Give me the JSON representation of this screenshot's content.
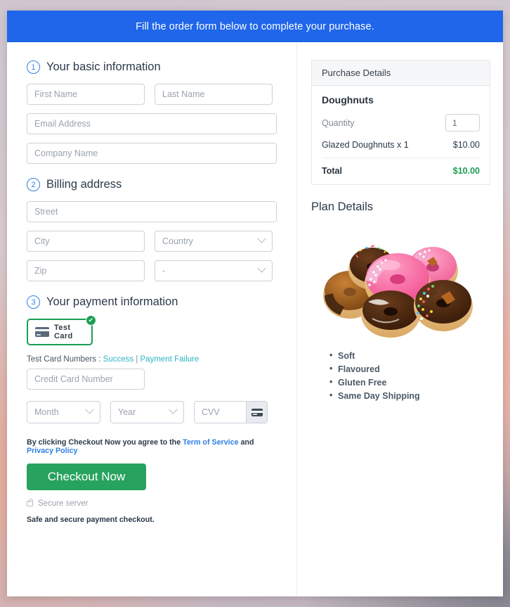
{
  "banner": {
    "text": "Fill the order form below to complete your purchase."
  },
  "basic": {
    "step": "1",
    "title": "Your basic information",
    "first_name_placeholder": "First Name",
    "last_name_placeholder": "Last Name",
    "email_placeholder": "Email Address",
    "company_placeholder": "Company Name"
  },
  "billing": {
    "step": "2",
    "title": "Billing address",
    "street_placeholder": "Street",
    "city_placeholder": "City",
    "country_value": "Country",
    "zip_placeholder": "Zip",
    "state_value": "-"
  },
  "payment": {
    "step": "3",
    "title": "Your payment information",
    "card_tile_label": "Test Card",
    "card_tile_selected_glyph": "✔",
    "test_numbers_prefix": "Test Card Numbers : ",
    "test_success_link": "Success",
    "test_separator": " | ",
    "test_failure_link": "Payment Failure",
    "card_number_placeholder": "Credit Card Number",
    "month_value": "Month",
    "year_value": "Year",
    "cvv_placeholder": "CVV",
    "terms_prefix": "By clicking Checkout Now you agree to the ",
    "terms_link": "Term of Service",
    "terms_middle": " and ",
    "privacy_link": "Privacy Policy",
    "checkout_label": "Checkout Now",
    "secure_server_label": "Secure server",
    "safe_note": "Safe and secure payment checkout."
  },
  "purchase": {
    "panel_title": "Purchase Details",
    "product": "Doughnuts",
    "quantity_label": "Quantity",
    "quantity_value": "1",
    "line_item_label": "Glazed Doughnuts x 1",
    "line_item_amount": "$10.00",
    "total_label": "Total",
    "total_amount": "$10.00"
  },
  "plan": {
    "title": "Plan Details",
    "image_alt": "doughnuts-photo",
    "features": [
      "Soft",
      "Flavoured",
      "Gluten Free",
      "Same Day Shipping"
    ]
  },
  "colors": {
    "banner_blue": "#1f66ea",
    "link_blue": "#2f7fe4",
    "link_teal": "#2cb4c4",
    "success_green": "#27a35e",
    "total_green": "#1b9e52"
  }
}
